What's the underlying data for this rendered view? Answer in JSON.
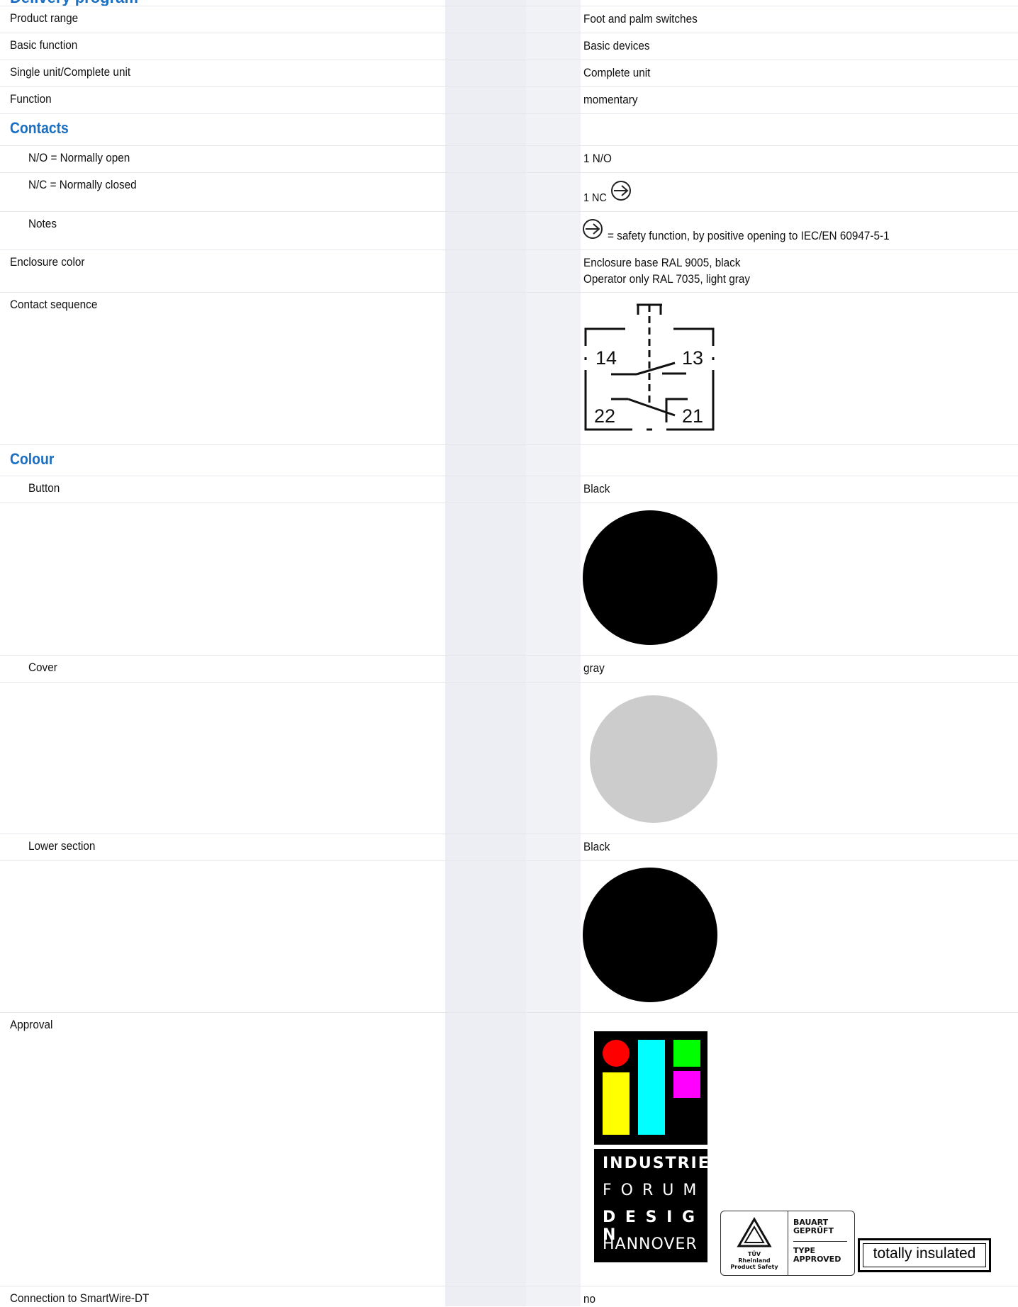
{
  "page_title": "Delivery program",
  "rows": {
    "product_range": {
      "label": "Product range",
      "value": "Foot and palm switches"
    },
    "basic_function": {
      "label": "Basic function",
      "value": "Basic devices"
    },
    "single_unit": {
      "label": "Single unit/Complete unit",
      "value": "Complete unit"
    },
    "function": {
      "label": "Function",
      "value": "momentary"
    },
    "contacts": {
      "label": "Contacts"
    },
    "no": {
      "label": "N/O = Normally open",
      "value": "1 N/O"
    },
    "nc": {
      "label": "N/C = Normally closed",
      "value": "1 NC"
    },
    "notes": {
      "label": "Notes",
      "value": "= safety function, by positive opening to IEC/EN 60947-5-1"
    },
    "enclosure_color": {
      "label": "Enclosure color",
      "value_line1": "Enclosure base RAL 9005, black",
      "value_line2": "Operator only RAL 7035, light gray"
    },
    "contact_sequence": {
      "label": "Contact sequence",
      "terminals": [
        "14",
        "13",
        "22",
        "21"
      ]
    },
    "colour": {
      "label": "Colour"
    },
    "button": {
      "label": "Button",
      "value": "Black",
      "swatch": "#000000"
    },
    "cover": {
      "label": "Cover",
      "value": "gray",
      "swatch": "#cccccc"
    },
    "lower_section": {
      "label": "Lower section",
      "value": "Black",
      "swatch": "#000000"
    },
    "approval": {
      "label": "Approval",
      "logos": {
        "if_words": [
          "INDUSTRIE",
          "F O R U M",
          "D E S I G N",
          "HANNOVER"
        ],
        "tuv_left": [
          "TÜV",
          "Rheinland",
          "Product Safety"
        ],
        "tuv_right_top": [
          "BAUART",
          "GEPRÜFT"
        ],
        "tuv_right_bottom": [
          "TYPE",
          "APPROVED"
        ],
        "totally_insulated": "totally insulated"
      }
    },
    "smartwire": {
      "label": "Connection to SmartWire-DT",
      "value": "no"
    }
  },
  "colors": {
    "accent": "#1a6fc2",
    "shade": "#eceef3"
  }
}
